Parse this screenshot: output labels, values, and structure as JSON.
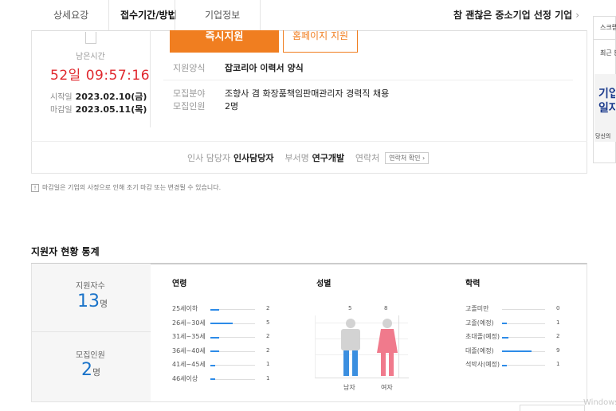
{
  "tabs": [
    {
      "label": "상세요강"
    },
    {
      "label": "접수기간/방법"
    },
    {
      "label": "기업정보"
    }
  ],
  "promo": {
    "label": "참 괜찮은 중소기업 선정 기업",
    "chevron": "›"
  },
  "apply": {
    "apply_button": "즉시지원",
    "resume_button": "홈페이지 지원"
  },
  "deadline": {
    "remaining_label": "남은시간",
    "remaining_days": "52",
    "days_unit": "일",
    "remaining_time": "09:57:16",
    "start_label": "시작일",
    "start_date": "2023.02.10(금)",
    "end_label": "마감일",
    "end_date": "2023.05.11(목)"
  },
  "info": {
    "method_label": "지원양식",
    "method_value": "잡코리아 이력서 양식",
    "field_label": "모집분야",
    "field_value": "조향사 겸 화장품책임판매관리자 경력직 채용",
    "count_label": "모집인원",
    "count_value": "2명"
  },
  "contact": {
    "hr_label": "인사 담당자",
    "hr_value": "인사담당자",
    "dept_label": "부서명",
    "dept_value": "연구개발",
    "phone_label": "연락처",
    "phone_button": "연락처 확인 ›"
  },
  "note": {
    "icon": "!",
    "text": "마감일은 기업의 사정으로 인해 조기 마감 또는 변경될 수 있습니다."
  },
  "stats": {
    "title": "지원자 현황 통계",
    "applicants_label": "지원자수",
    "applicants_num": "13",
    "applicants_unit": "명",
    "recruits_label": "모집인원",
    "recruits_num": "2",
    "recruits_unit": "명",
    "age_title": "연령",
    "age_rows": [
      {
        "label": "25세이하",
        "value": "2"
      },
      {
        "label": "26세~30세",
        "value": "5"
      },
      {
        "label": "31세~35세",
        "value": "2"
      },
      {
        "label": "36세~40세",
        "value": "2"
      },
      {
        "label": "41세~45세",
        "value": "1"
      },
      {
        "label": "46세이상",
        "value": "1"
      }
    ],
    "gender_title": "성별",
    "male_count": "5",
    "female_count": "8",
    "male_label": "남자",
    "female_label": "여자",
    "edu_title": "학력",
    "edu_rows": [
      {
        "label": "고졸미만",
        "value": "0"
      },
      {
        "label": "고졸(예정)",
        "value": "1"
      },
      {
        "label": "초대졸(예정)",
        "value": "2"
      },
      {
        "label": "대졸(예정)",
        "value": "9"
      },
      {
        "label": "석박사(예정)",
        "value": "1"
      }
    ]
  },
  "side": {
    "item1": "스크랩",
    "item2": "최근 본",
    "promo_big1": "기업",
    "promo_big2": "일자",
    "promo_small": "당신의"
  },
  "watermark": "Windows",
  "colors": {
    "accent": "#f07e20",
    "deadline_red": "#e0282e",
    "stat_blue": "#1a73c9",
    "male": "#3b8fe0",
    "female": "#f07a8c"
  }
}
